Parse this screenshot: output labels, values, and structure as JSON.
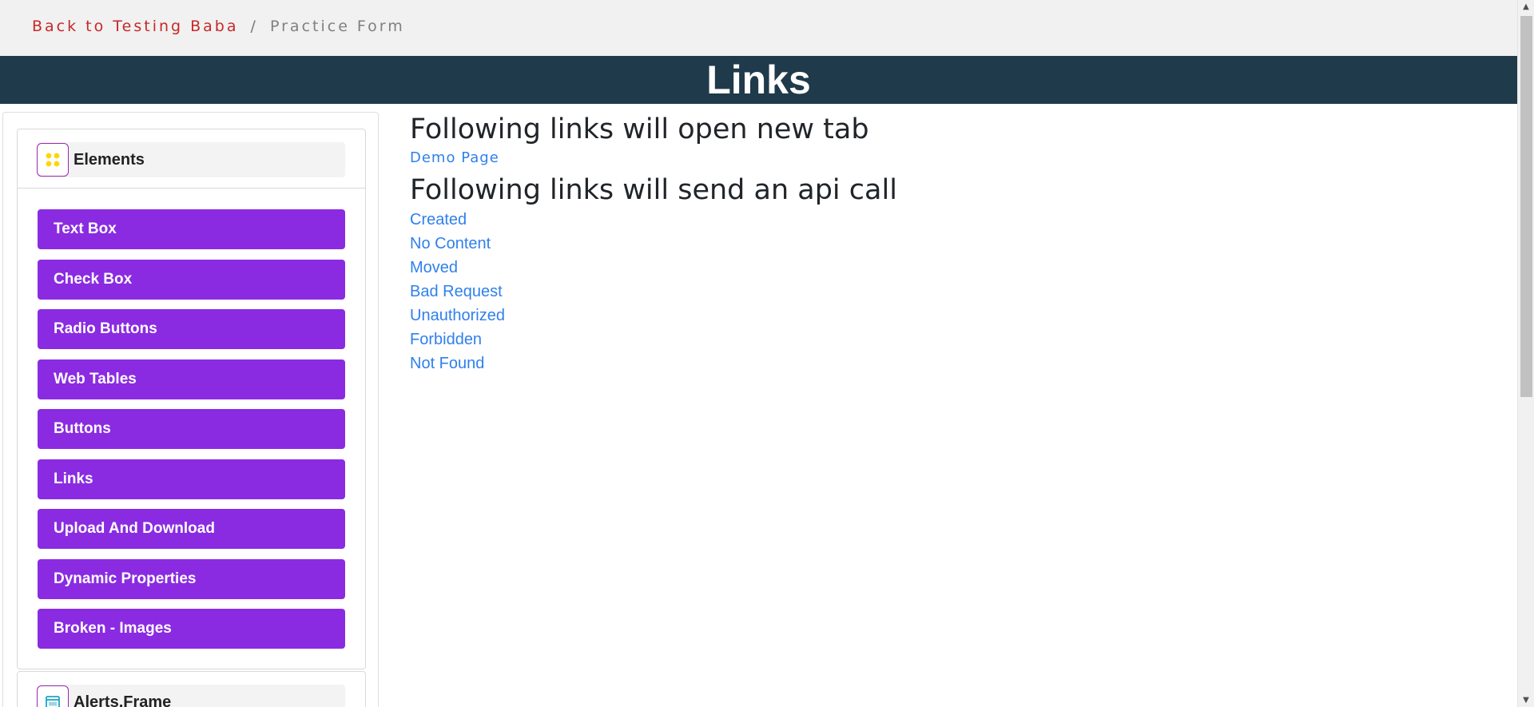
{
  "breadcrumb": {
    "back_label": "Back to Testing Baba",
    "separator": "/",
    "current": "Practice Form"
  },
  "header": {
    "title": "Links"
  },
  "sidebar": {
    "groups": [
      {
        "title": "Elements",
        "icon": "grid-dots-icon",
        "items": [
          {
            "label": "Text Box"
          },
          {
            "label": "Check Box"
          },
          {
            "label": "Radio Buttons"
          },
          {
            "label": "Web Tables"
          },
          {
            "label": "Buttons"
          },
          {
            "label": "Links"
          },
          {
            "label": "Upload And Download"
          },
          {
            "label": "Dynamic Properties"
          },
          {
            "label": "Broken - Images"
          }
        ]
      },
      {
        "title": "Alerts,Frame",
        "icon": "window-icon"
      }
    ]
  },
  "main": {
    "new_tab_heading": "Following links will open new tab",
    "demo_link": "Demo Page",
    "api_heading": "Following links will send an api call",
    "api_links": [
      {
        "label": "Created"
      },
      {
        "label": "No Content"
      },
      {
        "label": "Moved"
      },
      {
        "label": "Bad Request"
      },
      {
        "label": "Unauthorized"
      },
      {
        "label": "Forbidden"
      },
      {
        "label": "Not Found"
      }
    ]
  },
  "colors": {
    "header_band": "#1f3a4b",
    "menu_button": "#8a2be2",
    "link": "#2f80ed",
    "breadcrumb_link": "#c62828"
  }
}
